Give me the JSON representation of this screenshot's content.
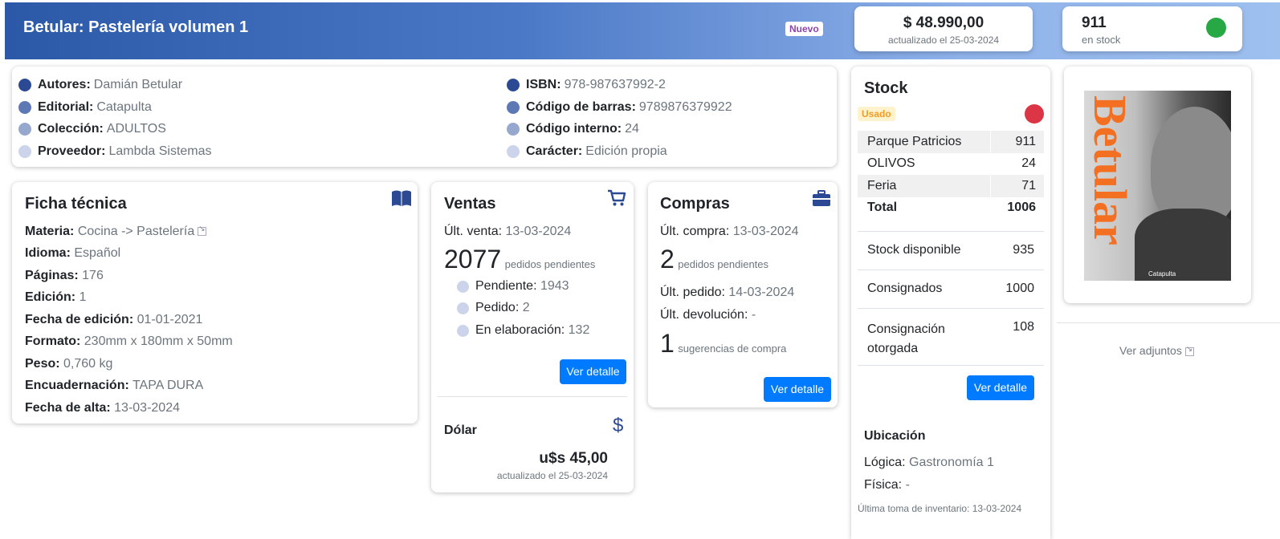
{
  "header": {
    "title": "Betular: Pastelería volumen 1",
    "badge": "Nuevo",
    "price": "$ 48.990,00",
    "price_updated": "actualizado el 25-03-2024",
    "stock_count": "911",
    "stock_label": "en stock"
  },
  "info": {
    "left": [
      {
        "label": "Autores:",
        "value": "Damián Betular"
      },
      {
        "label": "Editorial:",
        "value": "Catapulta"
      },
      {
        "label": "Colección:",
        "value": "ADULTOS"
      },
      {
        "label": "Proveedor:",
        "value": "Lambda Sistemas"
      }
    ],
    "right": [
      {
        "label": "ISBN:",
        "value": "978-987637992-2"
      },
      {
        "label": "Código de barras:",
        "value": "9789876379922"
      },
      {
        "label": "Código interno:",
        "value": "24"
      },
      {
        "label": "Carácter:",
        "value": "Edición propia"
      }
    ]
  },
  "ficha": {
    "title": "Ficha técnica",
    "fields": [
      {
        "label": "Materia:",
        "value": "Cocina -> Pastelería"
      },
      {
        "label": "Idioma:",
        "value": "Español"
      },
      {
        "label": "Páginas:",
        "value": "176"
      },
      {
        "label": "Edición:",
        "value": "1"
      },
      {
        "label": "Fecha de edición:",
        "value": "01-01-2021"
      },
      {
        "label": "Formato:",
        "value": "230mm x 180mm x 50mm"
      },
      {
        "label": "Peso:",
        "value": "0,760 kg"
      },
      {
        "label": "Encuadernación:",
        "value": "TAPA DURA"
      },
      {
        "label": "Fecha de alta:",
        "value": "13-03-2024"
      }
    ]
  },
  "ventas": {
    "title": "Ventas",
    "ult_label": "Últ. venta:",
    "ult_value": "13-03-2024",
    "pending_count": "2077",
    "pending_label": "pedidos pendientes",
    "breakdown": [
      {
        "label": "Pendiente:",
        "value": "1943"
      },
      {
        "label": "Pedido:",
        "value": "2"
      },
      {
        "label": "En elaboración:",
        "value": "132"
      }
    ],
    "button": "Ver detalle"
  },
  "dolar": {
    "title": "Dólar",
    "amount": "u$s 45,00",
    "updated": "actualizado el 25-03-2024"
  },
  "compras": {
    "title": "Compras",
    "ult_compra_label": "Últ. compra:",
    "ult_compra_value": "13-03-2024",
    "pending_count": "2",
    "pending_label": "pedidos pendientes",
    "ult_pedido_label": "Últ. pedido:",
    "ult_pedido_value": "14-03-2024",
    "ult_dev_label": "Últ. devolución:",
    "ult_dev_value": "-",
    "sug_count": "1",
    "sug_label": "sugerencias de compra",
    "button": "Ver detalle"
  },
  "stock": {
    "title": "Stock",
    "badge": "Usado",
    "rows": [
      {
        "name": "Parque Patricios",
        "qty": "911"
      },
      {
        "name": "OLIVOS",
        "qty": "24"
      },
      {
        "name": "Feria",
        "qty": "71"
      }
    ],
    "total_label": "Total",
    "total_value": "1006",
    "disponible_label": "Stock disponible",
    "disponible_value": "935",
    "consignados_label": "Consignados",
    "consignados_value": "1000",
    "otorgada_label": "Consignación otorgada",
    "otorgada_value": "108",
    "button": "Ver detalle",
    "ubicacion_title": "Ubicación",
    "logica_label": "Lógica:",
    "logica_value": "Gastronomía 1",
    "fisica_label": "Física:",
    "fisica_value": "-",
    "inventario": "Última toma de inventario: 13-03-2024"
  },
  "cover": {
    "title_text": "Betular",
    "publisher": "Catapulta",
    "attachments": "Ver adjuntos"
  },
  "colors": {
    "accent": "#007bff",
    "header_start": "#2c58a8",
    "stock_ok": "#28a745",
    "stock_alert": "#dc3545"
  }
}
